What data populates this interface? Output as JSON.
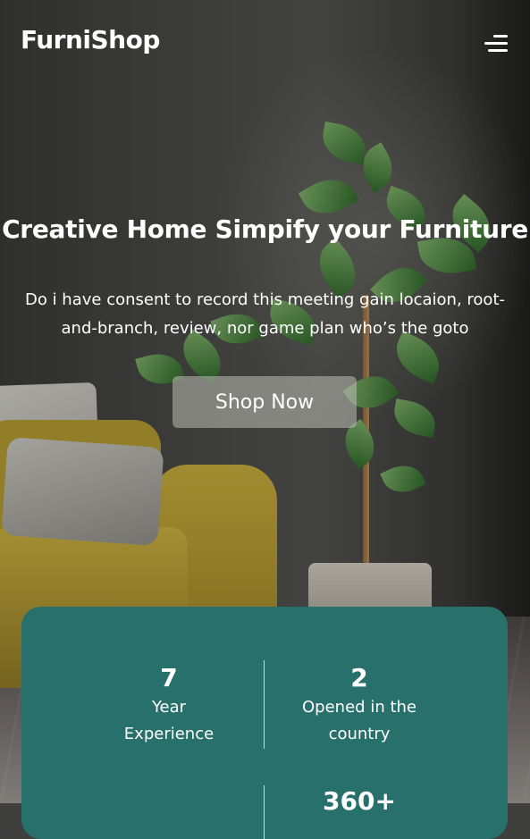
{
  "header": {
    "brand": "FurniShop",
    "menu_icon": "hamburger-menu-icon"
  },
  "hero": {
    "headline": "Creative Home Simpify your Furniture",
    "description": "Do i have consent to record this meeting gain locaion, root-and-branch, review, nor game plan who’s the goto",
    "cta_label": "Shop Now"
  },
  "stats": {
    "items": [
      {
        "value": "7",
        "label_line1": "Year",
        "label_line2": "Experience"
      },
      {
        "value": "2",
        "label_line1": "Opened in the",
        "label_line2": "country"
      },
      {
        "value": "",
        "label_line1": "",
        "label_line2": ""
      },
      {
        "value": "360+",
        "label_line1": "",
        "label_line2": ""
      }
    ]
  },
  "colors": {
    "stats_background": "#28706b",
    "text": "#ffffff"
  }
}
